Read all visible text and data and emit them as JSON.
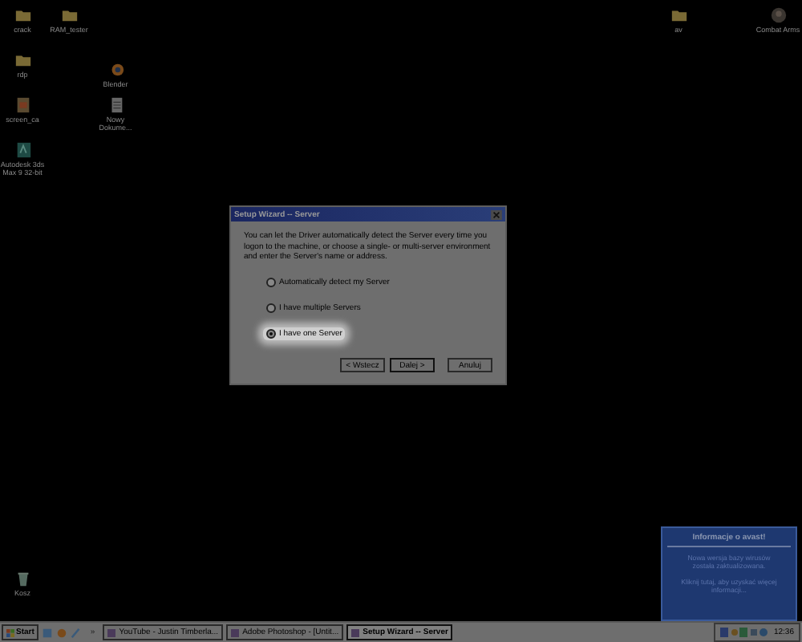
{
  "desktop_icons": [
    {
      "label": "crack",
      "kind": "folder"
    },
    {
      "label": "RAM_tester",
      "kind": "folder"
    },
    {
      "label": "rdp",
      "kind": "folder"
    },
    {
      "label": "Blender",
      "kind": "blender"
    },
    {
      "label": "screen_ca",
      "kind": "app"
    },
    {
      "label": "Nowy Dokume...",
      "kind": "document"
    },
    {
      "label": "Autodesk 3ds Max 9 32-bit",
      "kind": "max"
    },
    {
      "label": "av",
      "kind": "folder"
    },
    {
      "label": "Combat Arms",
      "kind": "game"
    },
    {
      "label": "Kosz",
      "kind": "trash"
    }
  ],
  "dialog": {
    "title": "Setup Wizard -- Server",
    "description": "You can let the Driver automatically detect the Server every time you logon to the machine, or choose a single- or multi-server environment and enter the Server's name or address.",
    "options": [
      {
        "label": "Automatically detect my Server",
        "selected": false
      },
      {
        "label": "I have multiple Servers",
        "selected": false
      },
      {
        "label": "I have one Server",
        "selected": true
      }
    ],
    "buttons": [
      {
        "label": "< Wstecz",
        "default": false
      },
      {
        "label": "Dalej >",
        "default": true
      },
      {
        "label": "Anuluj",
        "default": false
      }
    ]
  },
  "notification": {
    "title": "Informacje o avast!",
    "messages": [
      "Nowa wersja bazy wirusów została zaktualizowana.",
      "Kliknij tutaj, aby uzyskać więcej informacji..."
    ]
  },
  "taskbar": {
    "start": "Start",
    "chevron": "»",
    "tasks": [
      {
        "label": "YouTube - Justin Timberla...",
        "selected": false
      },
      {
        "label": "Adobe Photoshop - [Untit...",
        "selected": false
      },
      {
        "label": "Setup Wizard -- Server",
        "selected": true
      }
    ],
    "clock": "12:36"
  }
}
